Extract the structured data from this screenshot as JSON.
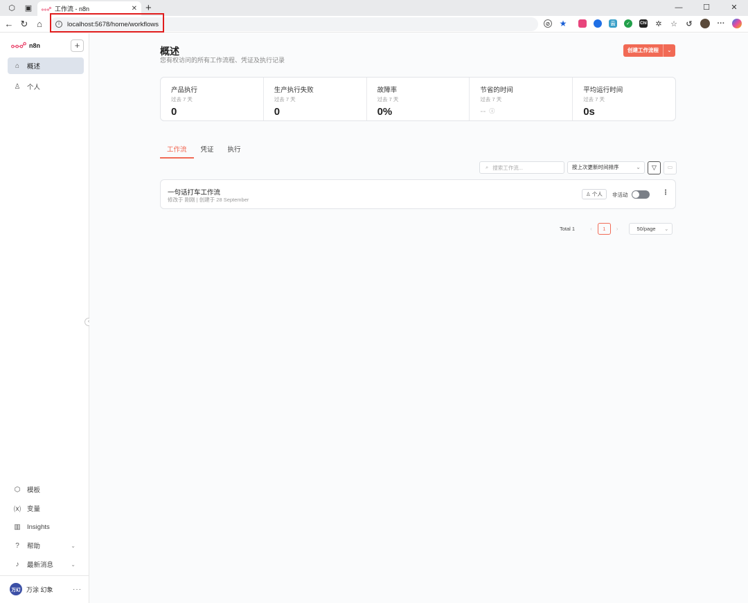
{
  "browser": {
    "tab_title": "工作流 - n8n",
    "url": "localhost:5678/home/workflows",
    "controls": {
      "minimize": "—",
      "maximize": "☐",
      "close": "✕"
    },
    "extension_labels": [
      "云",
      "ChI"
    ]
  },
  "sidebar": {
    "brand": "n8n",
    "add_label": "+",
    "nav": [
      {
        "label": "概述",
        "icon": "home-icon"
      },
      {
        "label": "个人",
        "icon": "user-icon"
      }
    ],
    "bottom": [
      {
        "label": "模板",
        "icon": "template-icon"
      },
      {
        "label": "变量",
        "icon": "variable-icon"
      },
      {
        "label": "Insights",
        "icon": "chart-icon"
      },
      {
        "label": "帮助",
        "icon": "help-icon"
      },
      {
        "label": "最新消息",
        "icon": "bell-icon"
      }
    ],
    "user": {
      "avatar_text": "万幻",
      "name": "万涂 幻象"
    }
  },
  "header": {
    "title": "概述",
    "subtitle": "您有权访问的所有工作流程、凭证及执行记录",
    "create_label": "创建工作流程"
  },
  "stats": [
    {
      "title": "产品执行",
      "period": "过去 7 天",
      "value": "0"
    },
    {
      "title": "生产执行失败",
      "period": "过去 7 天",
      "value": "0"
    },
    {
      "title": "故障率",
      "period": "过去 7 天",
      "value": "0%"
    },
    {
      "title": "节省的时间",
      "period": "过去 7 天",
      "value": "--"
    },
    {
      "title": "平均运行时间",
      "period": "过去 7 天",
      "value": "0s"
    }
  ],
  "tabs": [
    "工作流",
    "凭证",
    "执行"
  ],
  "toolbar": {
    "search_placeholder": "搜索工作流...",
    "sort_label": "按上次更新时间排序"
  },
  "workflows": [
    {
      "name": "一句话打车工作流",
      "meta": "修改于 刚刚 | 创建于 28 September",
      "owner": "个人",
      "status": "非活动"
    }
  ],
  "pagination": {
    "total": "Total 1",
    "page": "1",
    "page_size": "50/page"
  },
  "colors": {
    "accent": "#f16a55",
    "active_nav": "#dde3ec",
    "highlight_box": "#e01c1c"
  }
}
